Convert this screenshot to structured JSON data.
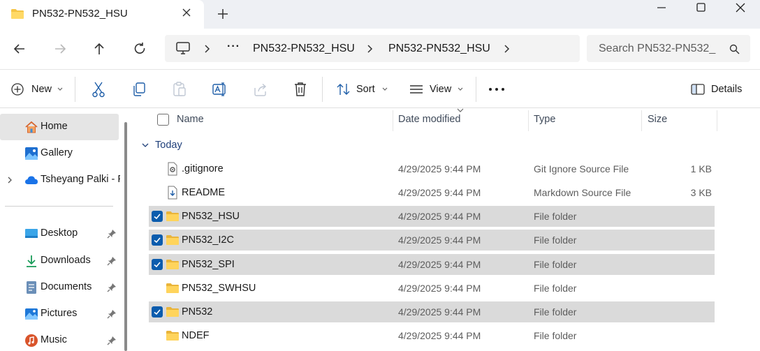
{
  "window": {
    "tab_title": "PN532-PN532_HSU",
    "new_tab_symbol": "+"
  },
  "address_bar": {
    "overflow": "···",
    "crumbs": [
      "PN532-PN532_HSU",
      "PN532-PN532_HSU"
    ],
    "search_placeholder": "Search PN532-PN532_"
  },
  "commands": {
    "new_label": "New",
    "sort_label": "Sort",
    "view_label": "View",
    "more_symbol": "···",
    "details_label": "Details"
  },
  "sidebar": {
    "items": [
      {
        "label": "Home",
        "icon": "home-icon",
        "selected": true
      },
      {
        "label": "Gallery",
        "icon": "gallery-icon"
      },
      {
        "label": "Tsheyang Palki - Personal",
        "icon": "onedrive-cloud-icon",
        "expandable": true
      },
      {
        "label": "Desktop",
        "icon": "desktop-icon",
        "pinned": true
      },
      {
        "label": "Downloads",
        "icon": "downloads-icon",
        "pinned": true
      },
      {
        "label": "Documents",
        "icon": "documents-icon",
        "pinned": true
      },
      {
        "label": "Pictures",
        "icon": "pictures-icon",
        "pinned": true
      },
      {
        "label": "Music",
        "icon": "music-icon",
        "pinned": true
      }
    ]
  },
  "columns": {
    "name": "Name",
    "date": "Date modified",
    "type": "Type",
    "size": "Size"
  },
  "group_label": "Today",
  "files": [
    {
      "name": ".gitignore",
      "date": "4/29/2025 9:44 PM",
      "type": "Git Ignore Source File",
      "size": "1 KB",
      "icon": "settings-file-icon",
      "selected": false
    },
    {
      "name": "README",
      "date": "4/29/2025 9:44 PM",
      "type": "Markdown Source File",
      "size": "3 KB",
      "icon": "markdown-file-icon",
      "selected": false
    },
    {
      "name": "PN532_HSU",
      "date": "4/29/2025 9:44 PM",
      "type": "File folder",
      "size": "",
      "icon": "folder-icon",
      "selected": true
    },
    {
      "name": "PN532_I2C",
      "date": "4/29/2025 9:44 PM",
      "type": "File folder",
      "size": "",
      "icon": "folder-icon",
      "selected": true
    },
    {
      "name": "PN532_SPI",
      "date": "4/29/2025 9:44 PM",
      "type": "File folder",
      "size": "",
      "icon": "folder-icon",
      "selected": true
    },
    {
      "name": "PN532_SWHSU",
      "date": "4/29/2025 9:44 PM",
      "type": "File folder",
      "size": "",
      "icon": "folder-icon",
      "selected": false
    },
    {
      "name": "PN532",
      "date": "4/29/2025 9:44 PM",
      "type": "File folder",
      "size": "",
      "icon": "folder-icon",
      "selected": true
    },
    {
      "name": "NDEF",
      "date": "4/29/2025 9:44 PM",
      "type": "File folder",
      "size": "",
      "icon": "folder-icon",
      "selected": false
    }
  ],
  "colors": {
    "accent": "#0b5cad",
    "selection": "#dadada",
    "folder": "#f5c445"
  }
}
